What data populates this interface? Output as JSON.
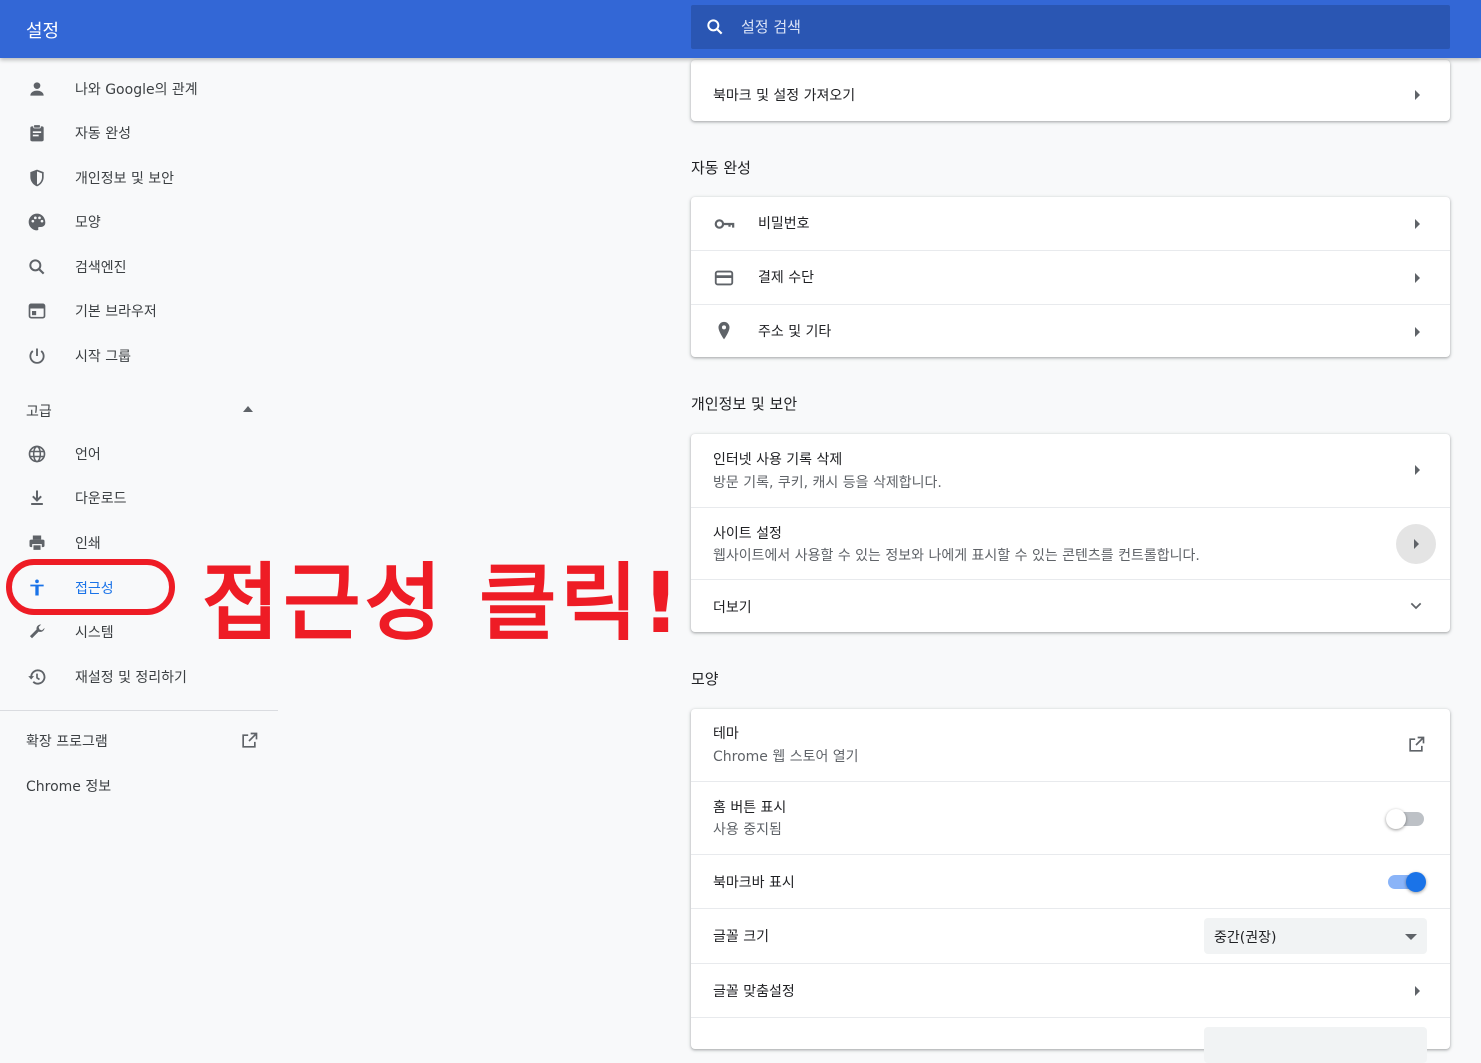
{
  "header": {
    "title": "설정",
    "search_placeholder": "설정 검색"
  },
  "sidebar": {
    "items": [
      {
        "label": "나와 Google의 관계",
        "icon": "person-icon"
      },
      {
        "label": "자동 완성",
        "icon": "clipboard-icon"
      },
      {
        "label": "개인정보 및 보안",
        "icon": "shield-icon"
      },
      {
        "label": "모양",
        "icon": "palette-icon"
      },
      {
        "label": "검색엔진",
        "icon": "search-icon"
      },
      {
        "label": "기본 브라우저",
        "icon": "browser-icon"
      },
      {
        "label": "시작 그룹",
        "icon": "power-icon"
      }
    ],
    "advanced_label": "고급",
    "advanced_items": [
      {
        "label": "언어",
        "icon": "globe-icon"
      },
      {
        "label": "다운로드",
        "icon": "download-icon"
      },
      {
        "label": "인쇄",
        "icon": "printer-icon"
      },
      {
        "label": "접근성",
        "icon": "accessibility-icon",
        "active": true
      },
      {
        "label": "시스템",
        "icon": "wrench-icon"
      },
      {
        "label": "재설정 및 정리하기",
        "icon": "restore-icon"
      }
    ],
    "extensions_label": "확장 프로그램",
    "about_label": "Chrome 정보"
  },
  "annotation": {
    "text": "접근성 클릭!",
    "color": "#ee1c25"
  },
  "main": {
    "import_row": "북마크 및 설정 가져오기",
    "autofill": {
      "title": "자동 완성",
      "rows": [
        {
          "label": "비밀번호",
          "icon": "key-icon"
        },
        {
          "label": "결제 수단",
          "icon": "credit-card-icon"
        },
        {
          "label": "주소 및 기타",
          "icon": "location-pin-icon"
        }
      ]
    },
    "privacy": {
      "title": "개인정보 및 보안",
      "rows": [
        {
          "title": "인터넷 사용 기록 삭제",
          "subtitle": "방문 기록, 쿠키, 캐시 등을 삭제합니다."
        },
        {
          "title": "사이트 설정",
          "subtitle": "웹사이트에서 사용할 수 있는 정보와 나에게 표시할 수 있는 콘텐츠를 컨트롤합니다."
        },
        {
          "title": "더보기"
        }
      ]
    },
    "appearance": {
      "title": "모양",
      "theme_title": "테마",
      "theme_subtitle": "Chrome 웹 스토어 열기",
      "home_title": "홈 버튼 표시",
      "home_subtitle": "사용 중지됨",
      "home_enabled": false,
      "bookmarks_bar": "북마크바 표시",
      "bookmarks_enabled": true,
      "font_size_label": "글꼴 크기",
      "font_size_value": "중간(권장)",
      "font_custom_label": "글꼴 맞춤설정"
    },
    "colors": {
      "accent": "#1a73e8",
      "header": "#3367d6"
    }
  }
}
